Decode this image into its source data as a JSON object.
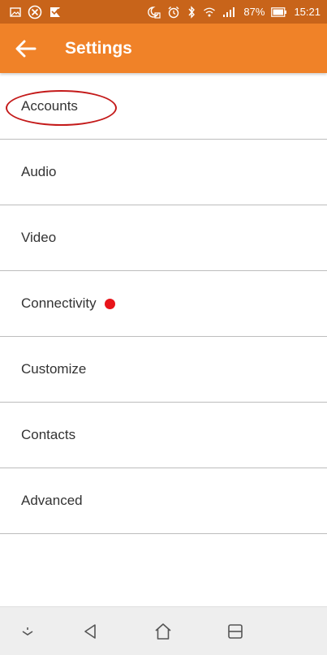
{
  "status_bar": {
    "icons_left": [
      "image-icon",
      "close-circle-icon",
      "app-notification-icon"
    ],
    "icons_right": [
      "do-not-disturb-icon",
      "alarm-icon",
      "bluetooth-icon",
      "wifi-icon",
      "signal-icon",
      "battery-icon"
    ],
    "battery_percent": "87%",
    "time": "15:21"
  },
  "app_bar": {
    "title": "Settings",
    "back_icon": "arrow-left-icon"
  },
  "settings": {
    "items": [
      {
        "label": "Accounts",
        "highlighted": true
      },
      {
        "label": "Audio"
      },
      {
        "label": "Video"
      },
      {
        "label": "Connectivity",
        "badge": "red-dot"
      },
      {
        "label": "Customize"
      },
      {
        "label": "Contacts"
      },
      {
        "label": "Advanced"
      }
    ]
  },
  "nav_bar": {
    "buttons": [
      "hide-icon",
      "back-icon",
      "home-icon",
      "recents-icon"
    ]
  },
  "colors": {
    "status_bar": "#c8641a",
    "app_bar": "#f08228",
    "highlight": "#c41a1a",
    "badge": "#e8141a",
    "divider": "#bdbdbd",
    "nav_bar": "#eeeeee"
  }
}
